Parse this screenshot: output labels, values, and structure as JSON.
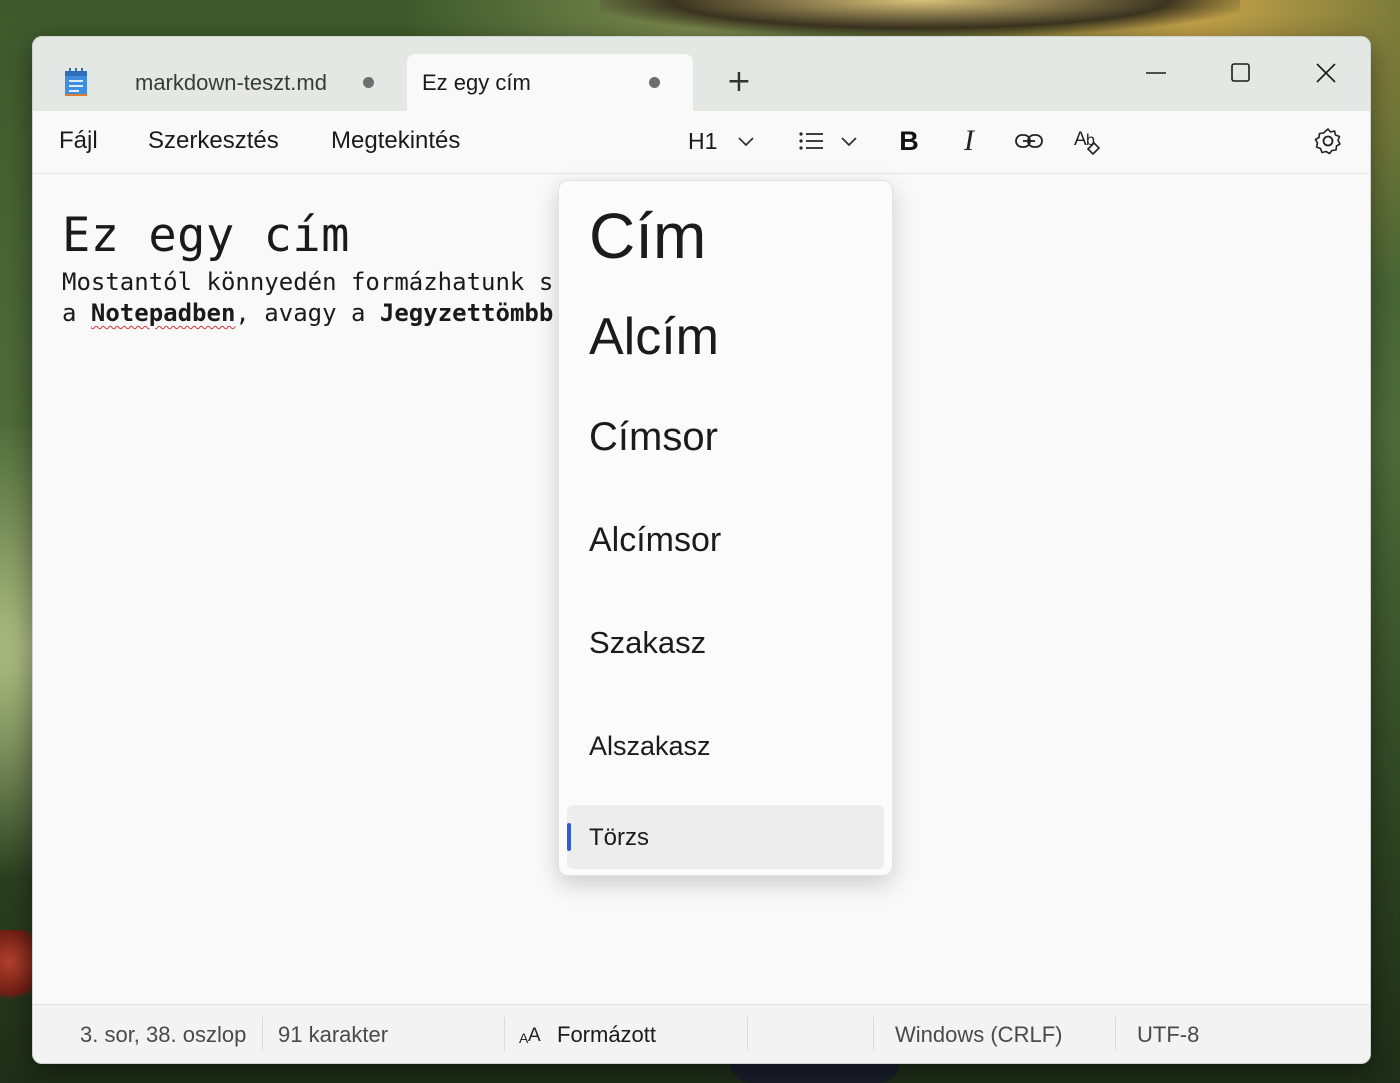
{
  "tabs": [
    {
      "label": "markdown-teszt.md",
      "unsaved": true,
      "active": false
    },
    {
      "label": "Ez egy cím",
      "unsaved": true,
      "active": true
    }
  ],
  "menu": {
    "file": "Fájl",
    "edit": "Szerkesztés",
    "view": "Megtekintés"
  },
  "toolbar": {
    "heading_value": "H1",
    "bold_glyph": "B",
    "italic_glyph": "I"
  },
  "document": {
    "title": "Ez egy cím",
    "line1": "Mostantól könnyedén formázhatunk s",
    "line2_prefix": "a ",
    "line2_bold1": "Notepadben",
    "line2_mid": ", avagy a ",
    "line2_bold2": "Jegyzettömbb"
  },
  "heading_menu": {
    "items": [
      "Cím",
      "Alcím",
      "Címsor",
      "Alcímsor",
      "Szakasz",
      "Alszakasz",
      "Törzs"
    ],
    "selected": "Törzs"
  },
  "statusbar": {
    "position": "3. sor, 38. oszlop",
    "characters": "91 karakter",
    "format": "Formázott",
    "line_endings": "Windows (CRLF)",
    "encoding": "UTF-8"
  },
  "colors": {
    "accent": "#2d5fd3",
    "spell_error": "#d13438"
  }
}
